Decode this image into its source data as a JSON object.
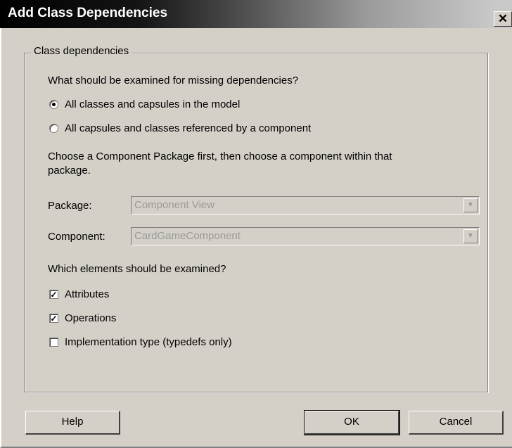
{
  "dialog": {
    "title": "Add Class Dependencies",
    "close_glyph": "✕"
  },
  "group": {
    "legend": "Class dependencies",
    "question": "What should be examined for missing dependencies?",
    "radios": [
      {
        "label": "All classes and capsules in the model",
        "selected": true
      },
      {
        "label": "All capsules and classes referenced by a component",
        "selected": false
      }
    ],
    "instruction_line1": "Choose a Component Package first, then choose a component within that",
    "instruction_line2": "package.",
    "package": {
      "label": "Package:",
      "value": "Component View",
      "enabled": false
    },
    "component": {
      "label": "Component:",
      "value": "CardGameComponent",
      "enabled": false
    },
    "elements_question": "Which elements should be examined?",
    "checkboxes": [
      {
        "label": "Attributes",
        "checked": true
      },
      {
        "label": "Operations",
        "checked": true
      },
      {
        "label": "Implementation type (typedefs only)",
        "checked": false
      }
    ]
  },
  "buttons": {
    "help": "Help",
    "ok": "OK",
    "cancel": "Cancel"
  },
  "glyphs": {
    "check_mark": "✓",
    "dropdown_arrow": "▼"
  }
}
